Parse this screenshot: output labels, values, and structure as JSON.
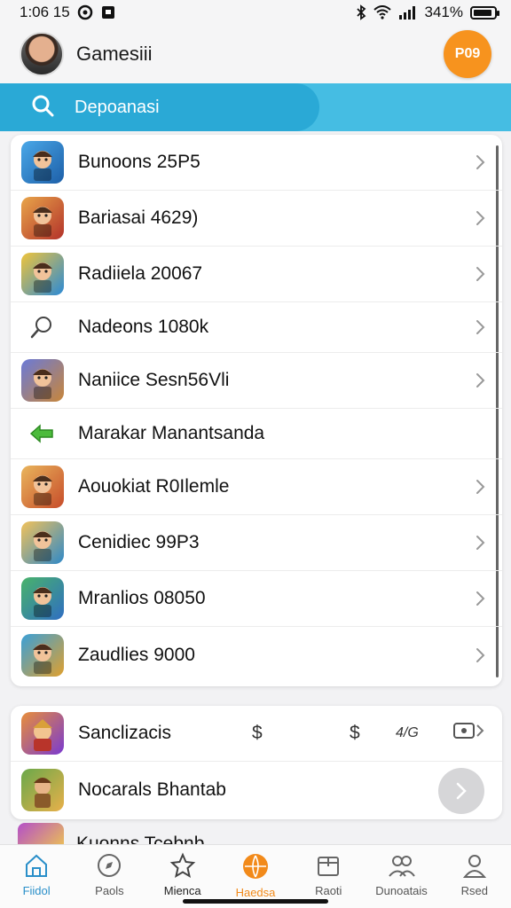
{
  "status_bar": {
    "time": "1:06 15",
    "battery": "341%"
  },
  "header": {
    "title": "Gamesiii",
    "badge": "P09"
  },
  "search": {
    "label": "Depoanasi"
  },
  "list": {
    "items": [
      {
        "label": "Bunoons 25P5",
        "icon": "game-icon-soldier",
        "colors": [
          "#4aa8e8",
          "#1d5fa8"
        ]
      },
      {
        "label": "Bariasai 4629)",
        "icon": "game-icon-warrior",
        "colors": [
          "#e8a54a",
          "#b3322a"
        ]
      },
      {
        "label": "Radiiela 20067",
        "icon": "game-icon-arcade",
        "colors": [
          "#f0c43a",
          "#2b8ad6"
        ]
      },
      {
        "label": "Nadeons 1080k",
        "icon": "search-icon",
        "colors": [
          "#ffffff",
          "#ffffff"
        ]
      },
      {
        "label": "Naniice Sesn56Vli",
        "icon": "game-icon-adventurer",
        "colors": [
          "#6a7ad8",
          "#c8863a"
        ]
      },
      {
        "label": "Marakar Manantsanda",
        "icon": "green-arrow-icon",
        "colors": [
          "#ffffff",
          "#ffffff"
        ]
      },
      {
        "label": "Aouokiat R0Ilemle",
        "icon": "game-icon-barbarian",
        "colors": [
          "#e9b55c",
          "#c74c2a"
        ]
      },
      {
        "label": "Cenidiec 99P3",
        "icon": "game-icon-shield",
        "colors": [
          "#f2c25a",
          "#2f89c8"
        ]
      },
      {
        "label": "Mranlios 08050",
        "icon": "game-icon-hero",
        "colors": [
          "#49b36a",
          "#2f6ec2"
        ]
      },
      {
        "label": "Zaudlies 9000",
        "icon": "game-icon-pirate",
        "colors": [
          "#3aa0d8",
          "#e0a02e"
        ]
      }
    ]
  },
  "secondary": {
    "items": [
      {
        "label": "Sanclizacis",
        "icon": "game-icon-knight",
        "col1": "$",
        "col2": "$",
        "col3": "4/G",
        "colors": [
          "#e88e3a",
          "#7a3ad0"
        ]
      },
      {
        "label": "Nocarals Bhantab",
        "icon": "game-icon-ranger",
        "colors": [
          "#6aa84a",
          "#e8b04a"
        ]
      }
    ],
    "peek_label": "Kuonns Tcebnb"
  },
  "nav": {
    "items": [
      {
        "label": "Fiidol",
        "icon": "home-icon"
      },
      {
        "label": "Paols",
        "icon": "compass-icon"
      },
      {
        "label": "Mienca",
        "icon": "star-icon"
      },
      {
        "label": "Haedsa",
        "icon": "ball-icon"
      },
      {
        "label": "Raoti",
        "icon": "box-icon"
      },
      {
        "label": "Dunoatais",
        "icon": "friends-icon"
      },
      {
        "label": "Rsed",
        "icon": "profile-icon"
      }
    ]
  },
  "colors": {
    "accent": "#45bde3",
    "accent_dark": "#2aa9d6",
    "badge": "#f7931e",
    "active_nav": "#f28a1a"
  }
}
